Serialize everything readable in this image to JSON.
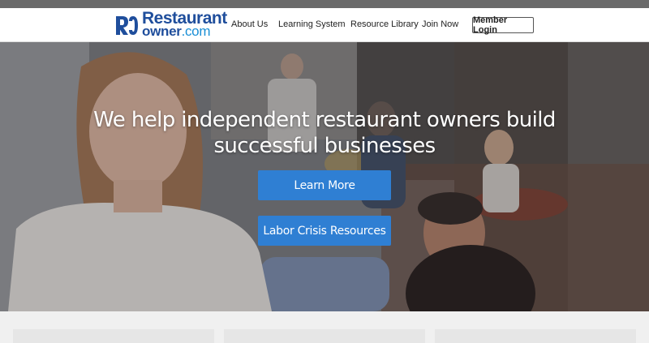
{
  "brand": {
    "logo_line1": "Restaurant",
    "logo_line2": "owner",
    "logo_tld": ".com",
    "primary_color": "#1f4e9c",
    "accent_color": "#1a8fd6"
  },
  "nav": {
    "items": [
      {
        "label": "About Us"
      },
      {
        "label": "Learning System"
      },
      {
        "label": "Resource Library"
      },
      {
        "label": "Join Now"
      }
    ],
    "login_label": "Member Login"
  },
  "hero": {
    "headline": "We help independent restaurant owners build successful businesses",
    "primary_cta": "Learn More",
    "secondary_cta": "Labor Crisis Resources",
    "button_color": "#2f7fd3"
  }
}
